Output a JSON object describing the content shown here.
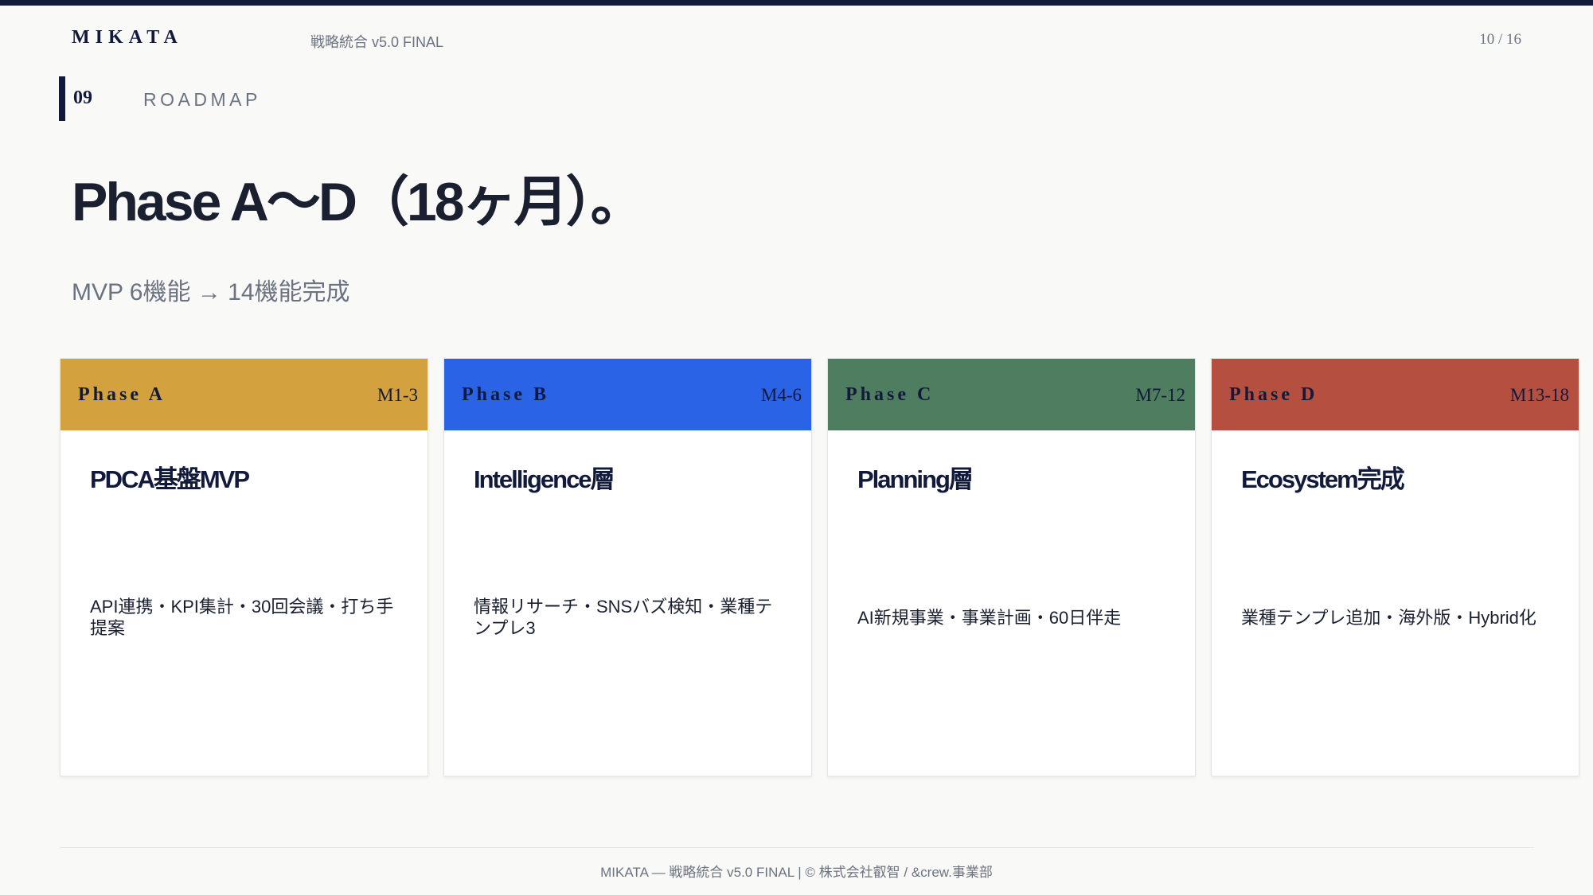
{
  "header": {
    "brand": "MIKATA",
    "doc_tag": "戦略統合 v5.0 FINAL",
    "page_indicator": "10 / 16"
  },
  "section": {
    "number": "09",
    "title": "ROADMAP"
  },
  "headline": "Phase A〜D（18ヶ月）。",
  "subheadline": "MVP 6機能 → 14機能完成",
  "phases": [
    {
      "label": "Phase A",
      "months": "M1-3",
      "title": "PDCA基盤MVP",
      "description": "API連携・KPI集計・30回会議・打ち手提案",
      "color": "#d3a23f"
    },
    {
      "label": "Phase B",
      "months": "M4-6",
      "title": "Intelligence層",
      "description": "情報リサーチ・SNSバズ検知・業種テンプレ3",
      "color": "#2a63e6"
    },
    {
      "label": "Phase C",
      "months": "M7-12",
      "title": "Planning層",
      "description": "AI新規事業・事業計画・60日伴走",
      "color": "#4f7d5f"
    },
    {
      "label": "Phase D",
      "months": "M13-18",
      "title": "Ecosystem完成",
      "description": "業種テンプレ追加・海外版・Hybrid化",
      "color": "#b55040"
    }
  ],
  "footer": "MIKATA — 戦略統合 v5.0 FINAL  |  © 株式会社叡智 / &crew.事業部"
}
